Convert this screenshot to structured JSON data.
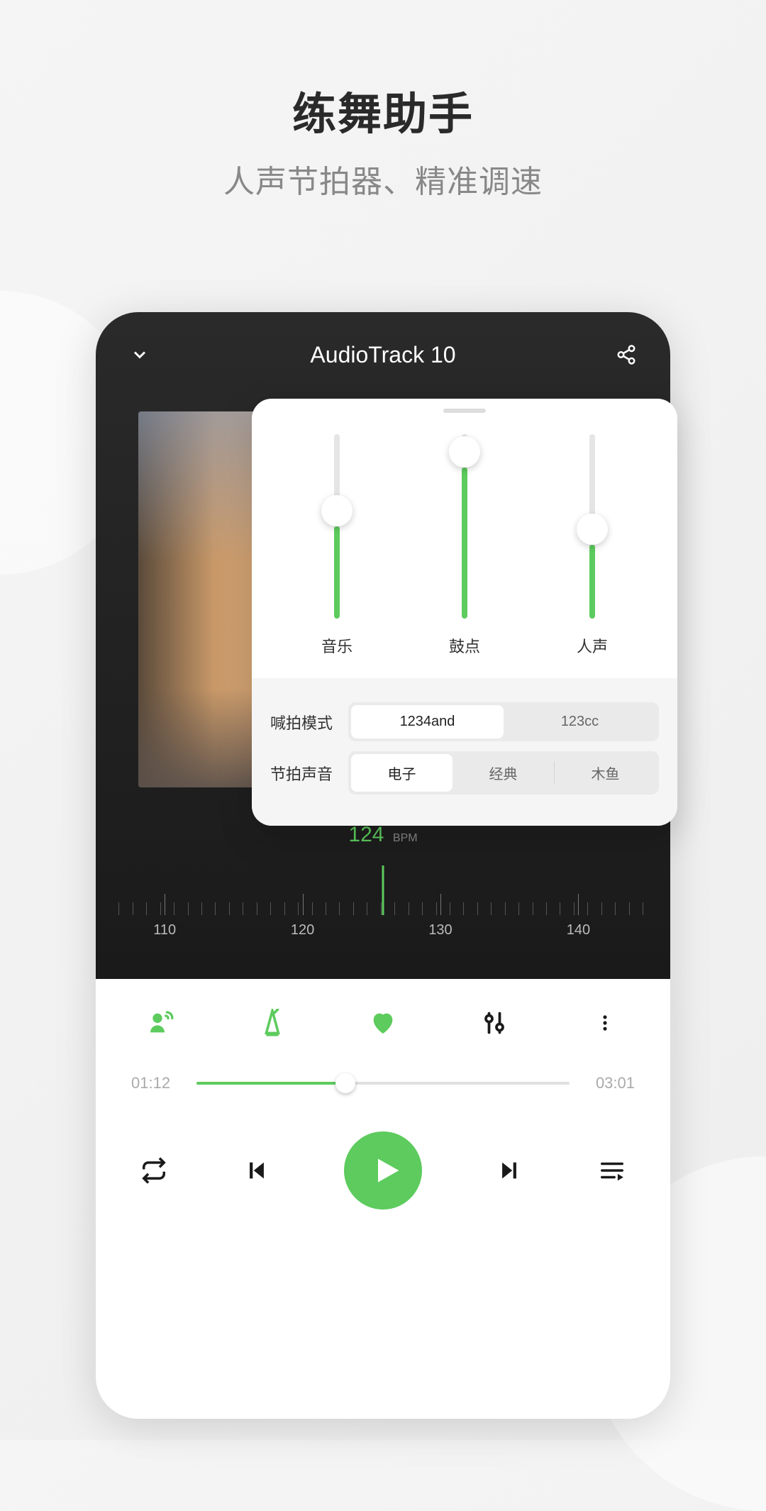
{
  "page": {
    "title": "练舞助手",
    "subtitle": "人声节拍器、精准调速"
  },
  "player": {
    "track_title": "AudioTrack 10",
    "bpm_value": "124",
    "bpm_unit": "BPM",
    "ruler_labels": [
      "110",
      "120",
      "130",
      "140"
    ],
    "elapsed": "01:12",
    "duration": "03:01",
    "progress_percent": 40
  },
  "popover": {
    "sliders": [
      {
        "label": "音乐",
        "percent": 50
      },
      {
        "label": "鼓点",
        "percent": 82
      },
      {
        "label": "人声",
        "percent": 40
      }
    ],
    "count_mode": {
      "label": "喊拍模式",
      "options": [
        "1234and",
        "123cc"
      ],
      "active_index": 0
    },
    "beat_sound": {
      "label": "节拍声音",
      "options": [
        "电子",
        "经典",
        "木鱼"
      ],
      "active_index": 0
    }
  },
  "colors": {
    "accent": "#5dcb5d"
  }
}
